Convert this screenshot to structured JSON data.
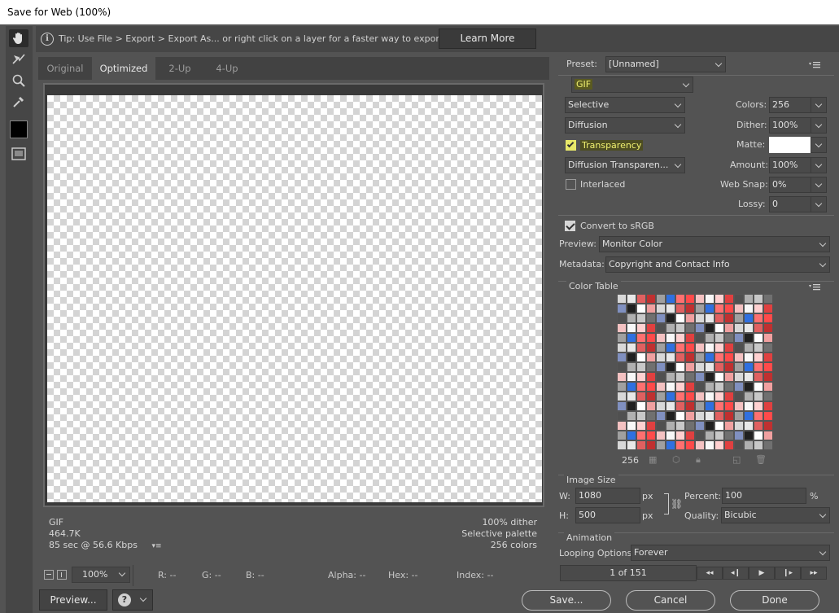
{
  "window": {
    "title": "Save for Web (100%)"
  },
  "tip": {
    "text": "Tip: Use File > Export > Export As...  or right click on a layer for a faster way to export assets",
    "learn_more": "Learn More"
  },
  "tools": [
    "hand-tool-icon",
    "slice-select-icon",
    "zoom-icon",
    "eyedropper-icon",
    "eyedropper-color-swatch",
    "toggle-slices-icon"
  ],
  "tabs": [
    "Original",
    "Optimized",
    "2-Up",
    "4-Up"
  ],
  "info": {
    "format": "GIF",
    "size": "464.7K",
    "time": "85 sec @ 56.6 Kbps",
    "dither": "100% dither",
    "palette": "Selective palette",
    "colors": "256 colors"
  },
  "status": {
    "zoom": "100%",
    "r": "R: --",
    "g": "G: --",
    "b": "B: --",
    "alpha": "Alpha: --",
    "hex": "Hex: --",
    "index": "Index: --"
  },
  "buttons": {
    "preview": "Preview...",
    "save": "Save...",
    "cancel": "Cancel",
    "done": "Done"
  },
  "preset": {
    "label": "Preset:",
    "value": "[Unnamed]"
  },
  "format": {
    "value": "GIF"
  },
  "reduction": {
    "value": "Selective"
  },
  "dither_algo": {
    "value": "Diffusion"
  },
  "transparency": {
    "label": "Transparency",
    "checked": true
  },
  "transparency_dither": {
    "value": "Diffusion Transparen..."
  },
  "interlaced": {
    "label": "Interlaced",
    "checked": false
  },
  "colors": {
    "label": "Colors:",
    "value": "256"
  },
  "dither": {
    "label": "Dither:",
    "value": "100%"
  },
  "matte": {
    "label": "Matte:",
    "color": "#ffffff"
  },
  "amount": {
    "label": "Amount:",
    "value": "100%"
  },
  "websnap": {
    "label": "Web Snap:",
    "value": "0%"
  },
  "lossy": {
    "label": "Lossy:",
    "value": "0"
  },
  "srgb": {
    "label": "Convert to sRGB",
    "checked": true
  },
  "preview_mode": {
    "label": "Preview:",
    "value": "Monitor Color"
  },
  "metadata": {
    "label": "Metadata:",
    "value": "Copyright and Contact Info"
  },
  "color_table": {
    "title": "Color Table",
    "count": "256"
  },
  "image_size": {
    "title": "Image Size",
    "w_label": "W:",
    "w_value": "1080",
    "h_label": "H:",
    "h_value": "500",
    "unit": "px",
    "percent_label": "Percent:",
    "percent_value": "100",
    "percent_unit": "%",
    "quality_label": "Quality:",
    "quality_value": "Bicubic"
  },
  "animation": {
    "title": "Animation",
    "looping_label": "Looping Options:",
    "looping_value": "Forever",
    "frame": "1 of 151"
  }
}
